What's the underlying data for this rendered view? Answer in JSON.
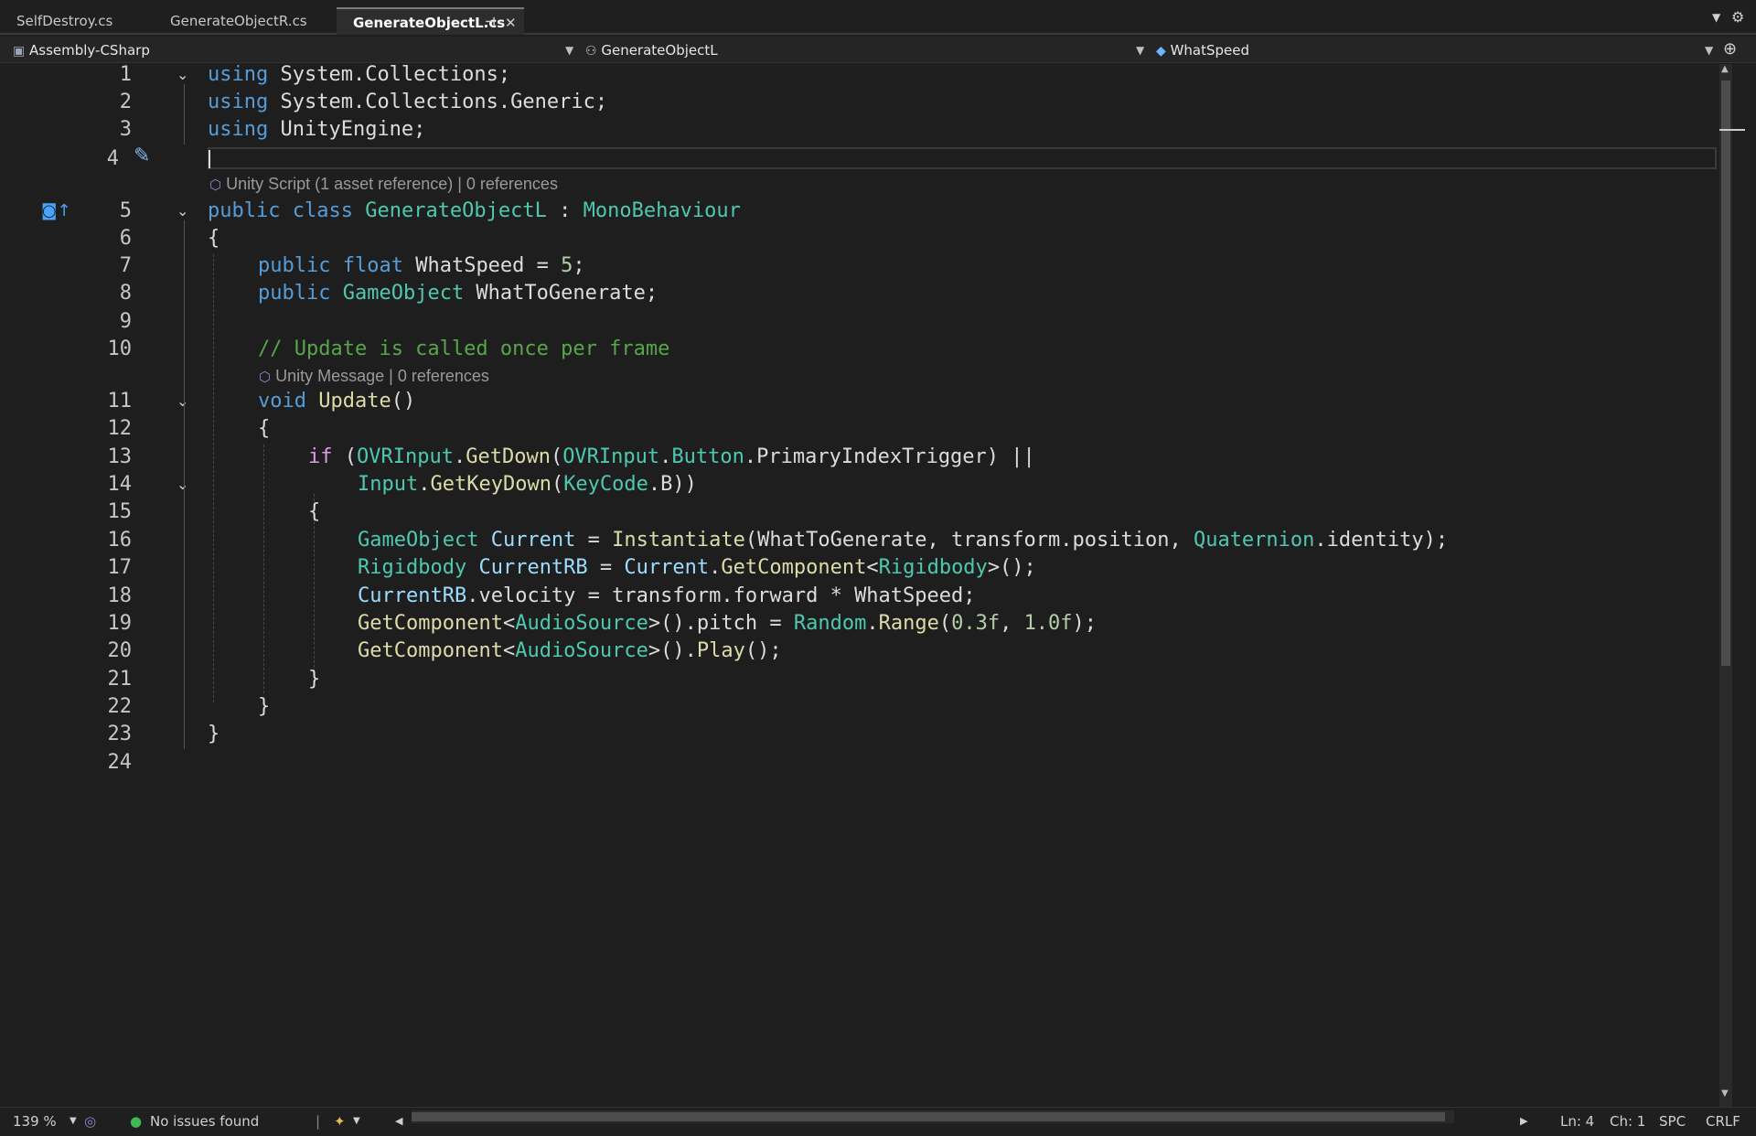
{
  "tabs": [
    {
      "label": "SelfDestroy.cs",
      "active": false
    },
    {
      "label": "GenerateObjectR.cs",
      "active": false
    },
    {
      "label": "GenerateObjectL.cs",
      "active": true
    }
  ],
  "navbar": {
    "project": "Assembly-CSharp",
    "type": "GenerateObjectL",
    "member": "WhatSpeed"
  },
  "lenses": {
    "class_lens": "Unity Script (1 asset reference) | 0 references",
    "method_lens": "Unity Message | 0 references"
  },
  "line_numbers": [
    "1",
    "2",
    "3",
    "4",
    "5",
    "6",
    "7",
    "8",
    "9",
    "10",
    "11",
    "12",
    "13",
    "14",
    "15",
    "16",
    "17",
    "18",
    "19",
    "20",
    "21",
    "22",
    "23",
    "24"
  ],
  "code": {
    "l1": {
      "kw": "using",
      "rest": " System.Collections;"
    },
    "l2": {
      "kw": "using",
      "rest": " System.Collections.Generic;"
    },
    "l3": {
      "kw": "using",
      "rest": " UnityEngine;"
    },
    "l5": {
      "kw1": "public",
      "kw2": "class",
      "cls": "GenerateObjectL",
      "colon": " : ",
      "base": "MonoBehaviour"
    },
    "l6": "{",
    "l7": {
      "kw1": "public",
      "kw2": "float",
      "rest": " WhatSpeed = ",
      "num": "5",
      "end": ";"
    },
    "l8": {
      "kw1": "public",
      "ty": "GameObject",
      "rest": " WhatToGenerate;"
    },
    "l10": "// Update is called once per frame",
    "l11": {
      "kw": "void",
      "fn": "Update",
      "rest": "()"
    },
    "l12": "{",
    "l13": {
      "ctl": "if",
      "p1": " (",
      "ty1": "OVRInput",
      "d1": ".",
      "fn1": "GetDown",
      "p2": "(",
      "ty2": "OVRInput",
      "d2": ".",
      "ty3": "Button",
      "rest": ".PrimaryIndexTrigger) ||"
    },
    "l14": {
      "ty1": "Input",
      "d1": ".",
      "fn1": "GetKeyDown",
      "p1": "(",
      "ty2": "KeyCode",
      "rest": ".B))"
    },
    "l15": "{",
    "l16": {
      "ty1": "GameObject",
      "vr1": " Current",
      "eq": " = ",
      "fn1": "Instantiate",
      "rest": "(WhatToGenerate, transform.position, ",
      "ty2": "Quaternion",
      "end": ".identity);"
    },
    "l17": {
      "ty1": "Rigidbody",
      "vr1": " CurrentRB",
      "eq": " = ",
      "vr2": "Current",
      "d1": ".",
      "fn1": "GetComponent",
      "lt": "<",
      "ty2": "Rigidbody",
      "end": ">();"
    },
    "l18": {
      "vr1": "CurrentRB",
      "rest": ".velocity = transform.forward * WhatSpeed;"
    },
    "l19": {
      "fn1": "GetComponent",
      "lt": "<",
      "ty1": "AudioSource",
      "mid": ">().pitch = ",
      "ty2": "Random",
      "d1": ".",
      "fn2": "Range",
      "p1": "(",
      "n1": "0.3f",
      "c": ", ",
      "n2": "1.0f",
      "end": ");"
    },
    "l20": {
      "fn1": "GetComponent",
      "lt": "<",
      "ty1": "AudioSource",
      "mid": ">().",
      "fn2": "Play",
      "end": "();"
    },
    "l21": "}",
    "l22": "}",
    "l23": "}"
  },
  "status": {
    "zoom": "139 %",
    "issues": "No issues found",
    "ln": "Ln: 4",
    "ch": "Ch: 1",
    "spc": "SPC",
    "crlf": "CRLF"
  },
  "colors": {
    "keyword": "#569cd6",
    "type": "#4ec9b0",
    "method": "#dcdcaa",
    "comment": "#57a64a",
    "number": "#b5cea8",
    "control": "#d8a0df",
    "ok": "#3fb950"
  },
  "icons": [
    "pin-icon",
    "close-icon",
    "dropdown-icon",
    "settings-icon",
    "project-icon",
    "class-icon",
    "field-icon",
    "split-icon",
    "screwdriver-icon",
    "bookmark-icon",
    "fold-icon",
    "check-circle-icon",
    "cleanup-icon"
  ]
}
